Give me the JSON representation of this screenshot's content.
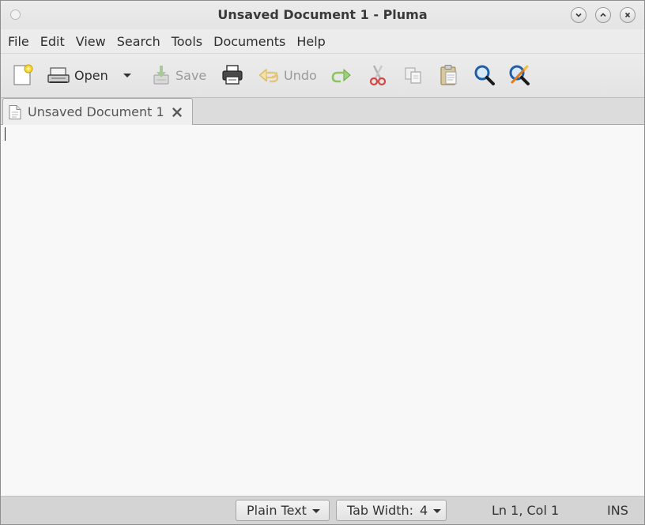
{
  "window": {
    "title": "Unsaved Document 1 - Pluma"
  },
  "menu": {
    "items": [
      "File",
      "Edit",
      "View",
      "Search",
      "Tools",
      "Documents",
      "Help"
    ]
  },
  "toolbar": {
    "new_icon": "new-document-icon",
    "open_label": "Open",
    "save_label": "Save",
    "undo_label": "Undo",
    "icons": [
      "new-document-icon",
      "open-folder-icon",
      "dropdown-arrow-icon",
      "save-icon",
      "print-icon",
      "undo-icon",
      "redo-icon",
      "cut-icon",
      "copy-icon",
      "paste-icon",
      "search-icon",
      "search-replace-icon"
    ]
  },
  "tabs": [
    {
      "label": "Unsaved Document 1",
      "icon": "document-icon",
      "active": true
    }
  ],
  "editor": {
    "content": ""
  },
  "statusbar": {
    "language": "Plain Text",
    "tab_width_label": "Tab Width:",
    "tab_width_value": "4",
    "position": "Ln 1, Col 1",
    "mode": "INS"
  },
  "colors": {
    "search_blue": "#1f5fa8",
    "accent_green": "#5aa02c",
    "cut_red": "#c03030"
  }
}
